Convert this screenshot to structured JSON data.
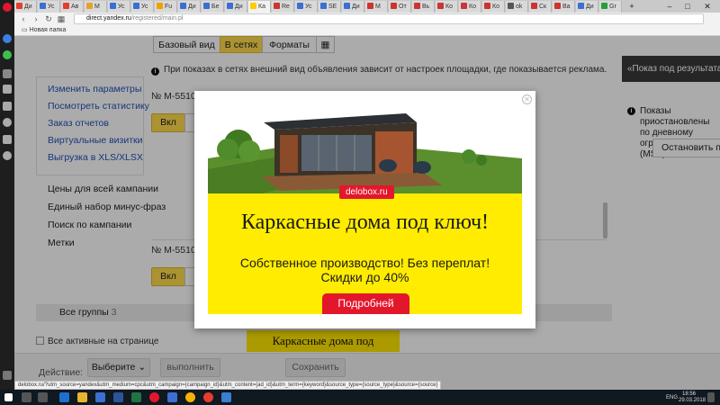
{
  "browser": {
    "tabs": [
      {
        "label": "Ди",
        "color": "#e63d2e"
      },
      {
        "label": "Ус",
        "color": "#3b6fd1"
      },
      {
        "label": "Ав",
        "color": "#e63d2e"
      },
      {
        "label": "М",
        "color": "#e6a12e"
      },
      {
        "label": "Ус",
        "color": "#3b6fd1"
      },
      {
        "label": "Ус",
        "color": "#3b6fd1"
      },
      {
        "label": "Fu",
        "color": "#f0a000"
      },
      {
        "label": "Ди",
        "color": "#3b6fd1"
      },
      {
        "label": "Бе",
        "color": "#3b6fd1"
      },
      {
        "label": "Ди",
        "color": "#3b6fd1"
      },
      {
        "label": "Ка",
        "color": "#ffcc00"
      },
      {
        "label": "Re",
        "color": "#c33"
      },
      {
        "label": "Ус",
        "color": "#3b6fd1"
      },
      {
        "label": "SE",
        "color": "#3b6fd1"
      },
      {
        "label": "Ди",
        "color": "#3b6fd1"
      },
      {
        "label": "М",
        "color": "#c33"
      },
      {
        "label": "От",
        "color": "#c33"
      },
      {
        "label": "Вь",
        "color": "#c33"
      },
      {
        "label": "Ко",
        "color": "#c33"
      },
      {
        "label": "Ко",
        "color": "#c33"
      },
      {
        "label": "Ко",
        "color": "#c33"
      },
      {
        "label": "ok",
        "color": "#555"
      },
      {
        "label": "Ск",
        "color": "#c33"
      },
      {
        "label": "Ва",
        "color": "#c33"
      },
      {
        "label": "Ди",
        "color": "#3b6fd1"
      },
      {
        "label": "Gr",
        "color": "#2a9d3a"
      }
    ],
    "url_host": "direct.yandex.ru",
    "url_path": "/registered/main.pl",
    "bookmark": "Новая папка",
    "status_url": "delobox.ru/?utm_source=yandex&utm_medium=cpc&utm_campaign={campaign_id}&utm_content={ad_id}&utm_term={keyword}&source_type={source_type}&source={source}"
  },
  "page": {
    "view_tabs": [
      "Базовый вид",
      "В сетях",
      "Форматы"
    ],
    "info_text": "При показах в сетях внешний вид объявления зависит от настроек площадки, где показывается реклама.",
    "dark_banner": "«Показ под результатами»",
    "left_links": [
      "Изменить параметры",
      "Посмотреть статистику",
      "Заказ отчетов",
      "Виртуальные визитки",
      "Выгрузка в XLS/XLSX"
    ],
    "left_plain": [
      "Цены для всей кампании",
      "Единый набор минус-фраз",
      "Поиск по кампании",
      "Метки"
    ],
    "ad_num_1": "№ М-5510",
    "ad_num_2": "№ М-5510",
    "on_label": "Вкл",
    "right_info": "Показы приостановлены по дневному ограничению (MSK)",
    "resume_button": "Остановить показы",
    "groups_label": "Все группы",
    "groups_count": "3",
    "active_checkbox": "Все активные на странице",
    "preview_text": "Каркасные дома под",
    "action_label": "Действие:",
    "select_value": "Выберите",
    "execute_button": "выполнить",
    "save_button": "Сохранить"
  },
  "modal": {
    "domain": "delobox.ru",
    "headline": "Каркасные дома под ключ!",
    "line1": "Собственное производство! Без переплат!",
    "line2": "Скидки до 40%",
    "cta": "Подробней"
  },
  "taskbar": {
    "lang": "ENG",
    "time": "18:56",
    "date": "29.03.2018"
  }
}
